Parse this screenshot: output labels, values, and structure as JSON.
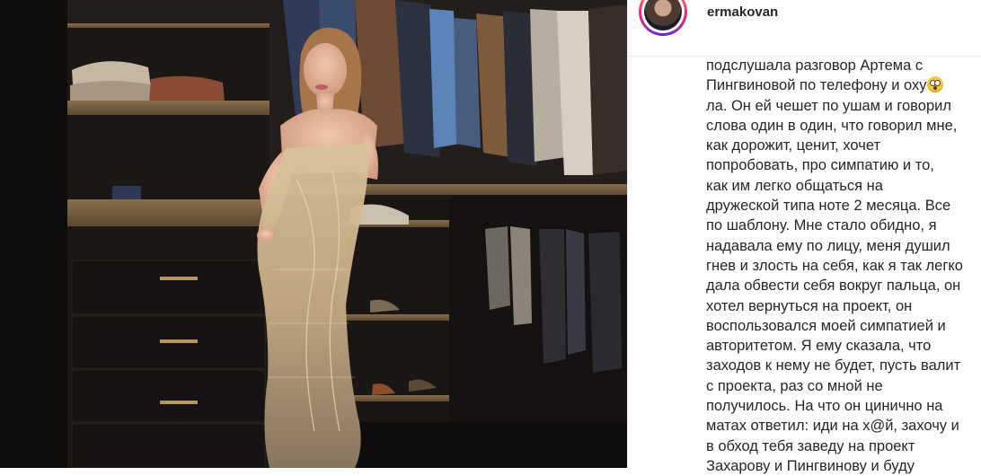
{
  "post": {
    "username": "ermakovan",
    "caption_lines": [
      "подслушала разговор Артема с",
      "Пингвиновой по телефону и оху",
      "ла. Он ей чешет по ушам и говорил",
      "слова один в один, что говорил мне,",
      "как дорожит, ценит, хочет",
      "попробовать, про симпатию и то,",
      "как им легко общаться на",
      "дружеской типа ноте 2 месяца. Все",
      "по шаблону. Мне стало обидно, я",
      "надавала ему по лицу, меня душил",
      "гнев и злость на себя, как я так легко",
      "дала обвести себя вокруг пальца, он",
      "хотел вернуться на проект, он",
      "воспользовался моей симпатией и",
      "авторитетом. Я ему сказала, что",
      "заходов к нему не будет, пусть валит",
      "с проекта, раз со мной не",
      "получилось. На что он цинично на",
      "матах ответил: иди на х@й, захочу и",
      "в обход тебя заведу на проект",
      "Захарову и Пингвинову и буду"
    ],
    "emoji_name": "flushed-face-emoji",
    "image_alt_icon": "photo-walk-in-closet"
  },
  "colors": {
    "text": "#262626",
    "border": "#efefef",
    "story_ring": "#ee2a7b"
  }
}
